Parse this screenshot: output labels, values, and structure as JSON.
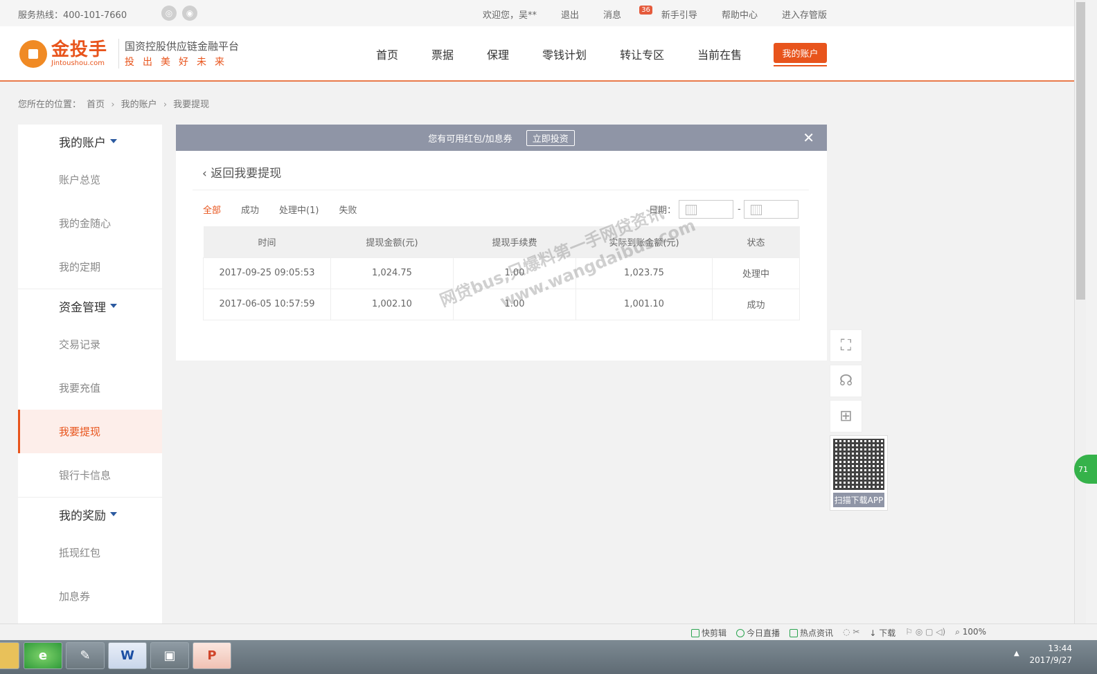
{
  "topbar": {
    "hotline": "服务热线：400-101-7660",
    "welcome": "欢迎您，吴**",
    "logout": "退出",
    "messages": "消息",
    "message_count": "36",
    "guide": "新手引导",
    "help": "帮助中心",
    "custody": "进入存管版"
  },
  "header": {
    "logo_name": "金投手",
    "logo_domain": "Jintoushou.com",
    "slogan_line1": "国资控股供应链金融平台",
    "slogan_line2": "投出美好未来",
    "nav": [
      "首页",
      "票据",
      "保理",
      "零钱计划",
      "转让专区",
      "当前在售"
    ],
    "account_button": "我的账户"
  },
  "breadcrumb": {
    "prefix": "您所在的位置：",
    "items": [
      "首页",
      "我的账户",
      "我要提现"
    ]
  },
  "sidebar": {
    "group1": "我的账户",
    "group1_items": [
      "账户总览",
      "我的金随心",
      "我的定期"
    ],
    "group2": "资金管理",
    "group2_items": [
      "交易记录",
      "我要充值",
      "我要提现",
      "银行卡信息"
    ],
    "group3": "我的奖励",
    "group3_items": [
      "抵现红包",
      "加息券"
    ]
  },
  "promo": {
    "text": "您有可用红包/加息券",
    "button": "立即投资"
  },
  "main": {
    "back": "返回我要提现",
    "filters": [
      "全部",
      "成功",
      "处理中(1)",
      "失败"
    ],
    "date_label": "日期：",
    "date_sep": "-"
  },
  "table": {
    "headers": [
      "时间",
      "提现金额(元)",
      "提现手续费",
      "实际到账金额(元)",
      "状态"
    ],
    "rows": [
      [
        "2017-09-25 09:05:53",
        "1,024.75",
        "1.00",
        "1,023.75",
        "处理中"
      ],
      [
        "2017-06-05 10:57:59",
        "1,002.10",
        "1.00",
        "1,001.10",
        "成功"
      ]
    ]
  },
  "watermark": {
    "line1": "网贷bus,只爆料第一手网贷资讯",
    "line2": "www.wangdaibus.com"
  },
  "qr": {
    "caption": "扫描下载APP"
  },
  "green_ball": "71",
  "statusbar": {
    "items": [
      "快剪辑",
      "今日直播",
      "热点资讯",
      "下载"
    ],
    "zoom": "100%"
  },
  "taskbar": {
    "time": "13:44",
    "date": "2017/9/27"
  }
}
